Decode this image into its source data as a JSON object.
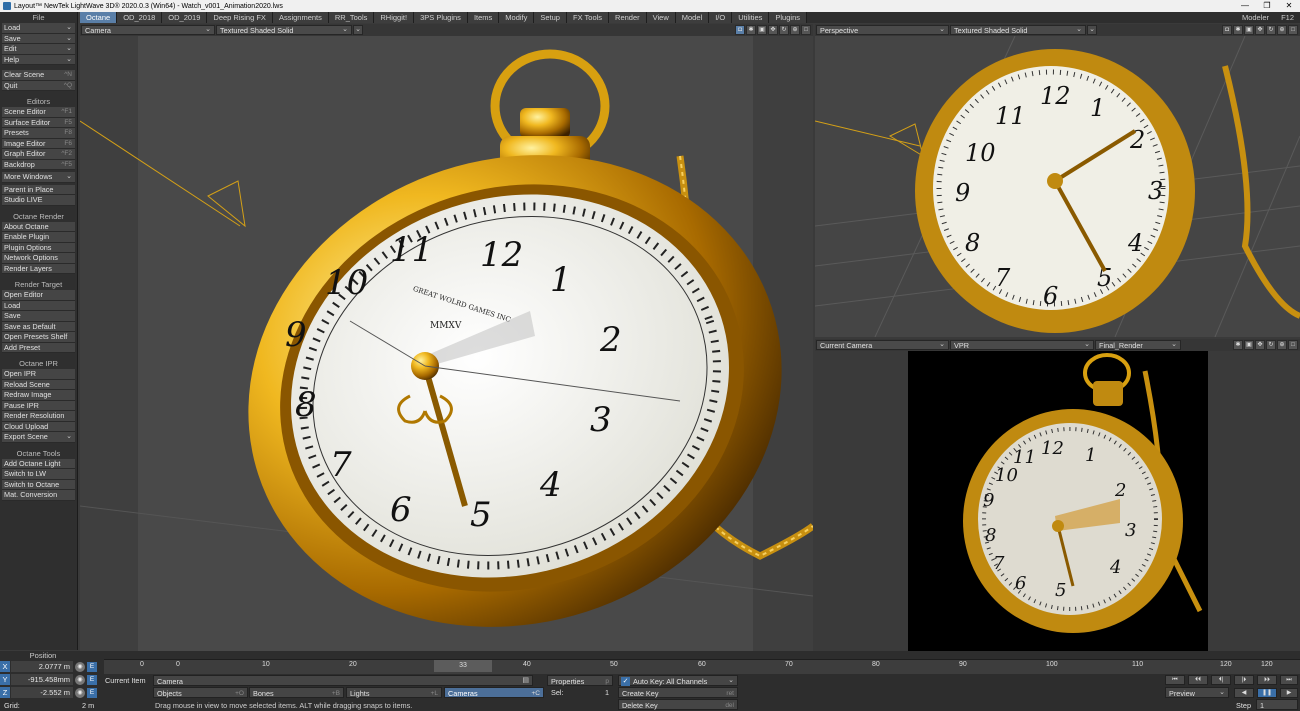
{
  "window": {
    "title": "Layout™ NewTek LightWave 3D® 2020.0.3 (Win64) - Watch_v001_Animation2020.lws",
    "controls": [
      "—",
      "❐",
      "✕"
    ]
  },
  "tabs": [
    "Octane",
    "OD_2018",
    "OD_2019",
    "Deep Rising FX",
    "Assignments",
    "RR_Tools",
    "RHiggit!",
    "3PS Plugins",
    "Items",
    "Modify",
    "Setup",
    "FX Tools",
    "Render",
    "View",
    "Model",
    "I/O",
    "Utilities",
    "Plugins"
  ],
  "tabs_right": {
    "modeler": "Modeler",
    "key": "F12"
  },
  "left_panel": {
    "file_head": "File",
    "file_items": [
      {
        "label": "Load",
        "dd": "⌄"
      },
      {
        "label": "Save",
        "dd": "⌄"
      },
      {
        "label": "Edit",
        "dd": "⌄"
      },
      {
        "label": "Help",
        "dd": "⌄"
      }
    ],
    "clear_scene": {
      "label": "Clear Scene",
      "sc": "^N"
    },
    "quit": {
      "label": "Quit",
      "sc": "^Q"
    },
    "editors_head": "Editors",
    "editors": [
      {
        "label": "Scene Editor",
        "sc": "^F1"
      },
      {
        "label": "Surface Editor",
        "sc": "F5"
      },
      {
        "label": "Presets",
        "sc": "F8"
      },
      {
        "label": "Image Editor",
        "sc": "F6"
      },
      {
        "label": "Graph Editor",
        "sc": "^F2"
      },
      {
        "label": "Backdrop",
        "sc": "^F5"
      }
    ],
    "more_windows": {
      "label": "More Windows",
      "dd": "⌄"
    },
    "parent_in_place": "Parent in Place",
    "studio_live": "Studio LIVE",
    "octane_render_head": "Octane Render",
    "octane_render": [
      "About Octane",
      "Enable Plugin",
      "Plugin Options",
      "Network Options",
      "Render Layers"
    ],
    "render_target_head": "Render Target",
    "render_target": [
      "Open Editor",
      "Load",
      "Save",
      "Save as Default",
      "Open Presets Shelf",
      "Add Preset"
    ],
    "octane_ipr_head": "Octane IPR",
    "octane_ipr": [
      "Open IPR",
      "Reload Scene",
      "Redraw Image",
      "Pause IPR",
      "Render Resolution",
      "Cloud Upload"
    ],
    "export_scene": {
      "label": "Export Scene",
      "dd": "⌄"
    },
    "octane_tools_head": "Octane Tools",
    "octane_tools": [
      "Add Octane Light",
      "Switch to LW",
      "Switch to Octane",
      "Mat. Conversion"
    ]
  },
  "viewports": {
    "main": {
      "view": "Camera",
      "shading": "Textured Shaded Solid"
    },
    "persp": {
      "view": "Perspective",
      "shading": "Textured Shaded Solid"
    },
    "render": {
      "view": "Current Camera",
      "shading": "VPR",
      "preset": "Final_Render"
    }
  },
  "watch": {
    "numerals": [
      "12",
      "1",
      "2",
      "3",
      "4",
      "5",
      "6",
      "7",
      "8",
      "9",
      "10",
      "11"
    ],
    "brand": "GREAT WOLRD GAMES INC",
    "year": "MMXV"
  },
  "bottom": {
    "position_head": "Position",
    "x": {
      "label": "X",
      "value": "2.0777 m"
    },
    "y": {
      "label": "Y",
      "value": "-915.458mm"
    },
    "z": {
      "label": "Z",
      "value": "-2.552 m"
    },
    "grid_label": "Grid:",
    "grid_value": "2 m",
    "timeline_ticks": [
      "0",
      "10",
      "20",
      "30",
      "40",
      "50",
      "60",
      "70",
      "80",
      "90",
      "100",
      "110",
      "120"
    ],
    "current_frame": "33",
    "end_frame": "120",
    "start_frame": "0",
    "current_item_label": "Current Item",
    "current_item": "Camera",
    "objects": {
      "label": "Objects",
      "sc": "+O"
    },
    "bones": {
      "label": "Bones",
      "sc": "+B"
    },
    "lights": {
      "label": "Lights",
      "sc": "+L"
    },
    "cameras": {
      "label": "Cameras",
      "sc": "+C"
    },
    "properties": {
      "label": "Properties",
      "sc": "p"
    },
    "sel_label": "Sel:",
    "sel_value": "1",
    "auto_key": "Auto Key: All Channels",
    "create_key": {
      "label": "Create Key",
      "sc": "ret"
    },
    "delete_key": {
      "label": "Delete Key",
      "sc": "del"
    },
    "preview": "Preview",
    "step_label": "Step",
    "step_value": "1",
    "status": "Drag mouse in view to move selected items. ALT while dragging snaps to items."
  }
}
